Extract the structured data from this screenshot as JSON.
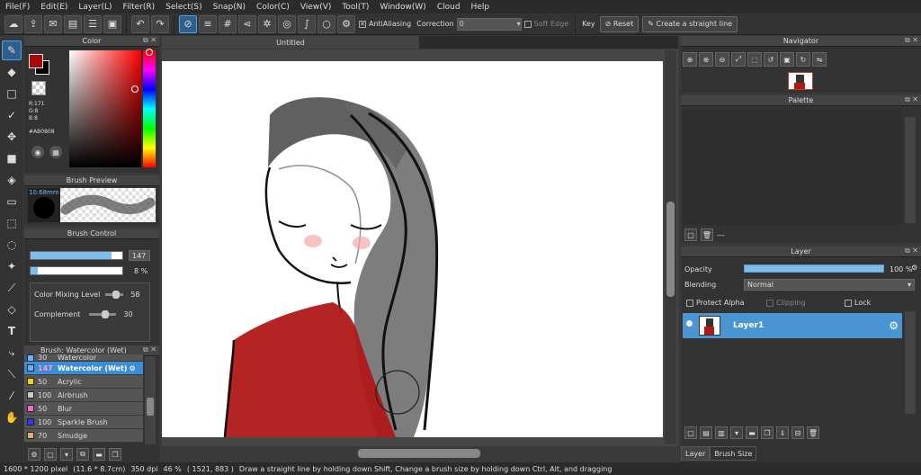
{
  "menu": [
    "File(F)",
    "Edit(E)",
    "Layer(L)",
    "Filter(R)",
    "Select(S)",
    "Snap(N)",
    "Color(C)",
    "View(V)",
    "Tool(T)",
    "Window(W)",
    "Cloud",
    "Help"
  ],
  "toolbar": {
    "antialiasing_label": "AntiAliasing",
    "correction_label": "Correction",
    "correction_value": "0",
    "soft_edge_label": "Soft Edge",
    "key_label": "Key",
    "reset_label": "Reset",
    "straight_line_label": "Create a straight line"
  },
  "color_panel": {
    "title": "Color",
    "r": "R:171",
    "g": "G:8",
    "b": "B:8",
    "hex": "#AB0808",
    "fg_color": "#AB0808"
  },
  "brush_preview": {
    "title": "Brush Preview",
    "size": "10.68mm"
  },
  "brush_control": {
    "title": "Brush Control",
    "size_value": "147",
    "size_fraction": 0.88,
    "opacity_value": "8 %",
    "opacity_fraction": 0.08,
    "color_mixing_label": "Color Mixing Level",
    "color_mixing_value": "58",
    "complement_label": "Complement",
    "complement_value": "30"
  },
  "brush_list": {
    "title": "Brush: Watercolor (Wet)",
    "items": [
      {
        "num": "30",
        "name": "Watercolor",
        "color": "#66b2ff"
      },
      {
        "num": "147",
        "name": "Watercolor (Wet)",
        "color": "#66b2ff",
        "selected": true
      },
      {
        "num": "50",
        "name": "Acrylic",
        "color": "#f5d800"
      },
      {
        "num": "100",
        "name": "Airbrush",
        "color": "#cccccc"
      },
      {
        "num": "50",
        "name": "Blur",
        "color": "#ff66cc"
      },
      {
        "num": "100",
        "name": "Sparkle Brush",
        "color": "#3333ff"
      },
      {
        "num": "70",
        "name": "Smudge",
        "color": "#e0b070"
      }
    ]
  },
  "canvas": {
    "tab_title": "Untitled"
  },
  "navigator": {
    "title": "Navigator"
  },
  "palette": {
    "title": "Palette",
    "footer_text": "---"
  },
  "layer_panel": {
    "title": "Layer",
    "opacity_label": "Opacity",
    "opacity_value": "100 %",
    "blending_label": "Blending",
    "blending_value": "Normal",
    "protect_alpha_label": "Protect Alpha",
    "clipping_label": "Clipping",
    "lock_label": "Lock",
    "layer_name": "Layer1"
  },
  "bottom_tabs": [
    "Layer",
    "Brush Size"
  ],
  "status": {
    "size": "1600 * 1200 pixel",
    "physical": "(11.6 * 8.7cm)",
    "dpi": "350 dpi",
    "zoom": "46 %",
    "coords": "( 1521, 883 )",
    "hint": "Draw a straight line by holding down Shift, Change a brush size by holding down Ctrl, Alt, and dragging"
  }
}
